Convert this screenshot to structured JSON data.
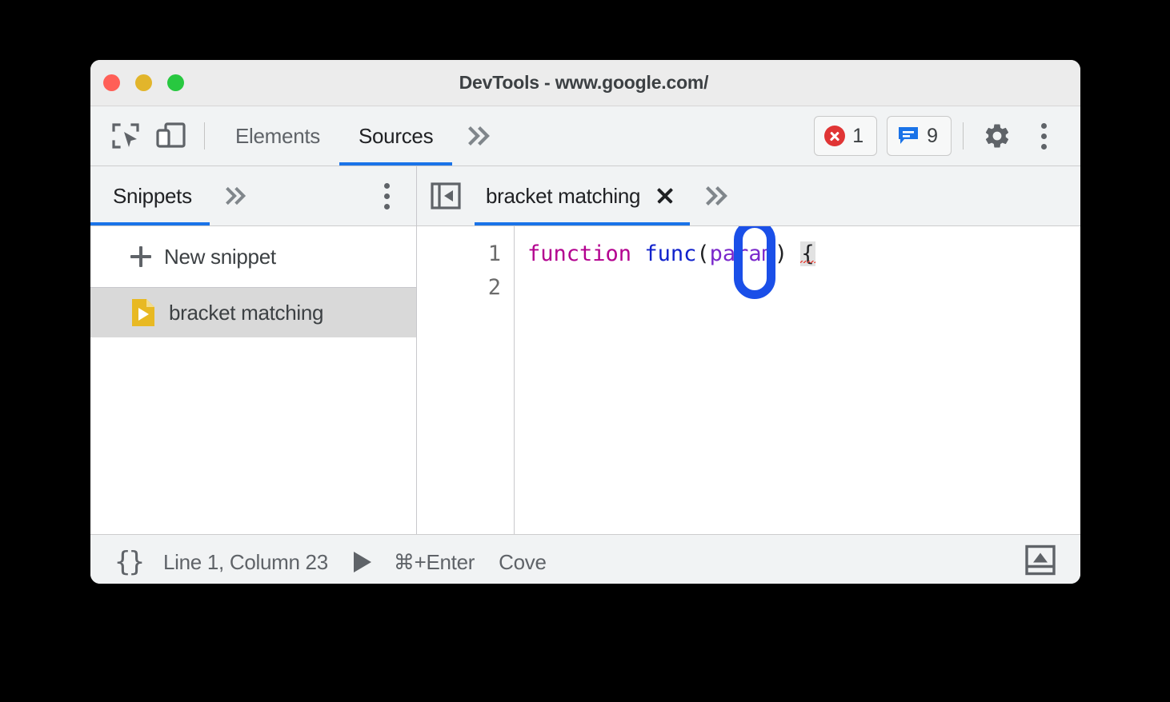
{
  "window": {
    "title": "DevTools - www.google.com/",
    "traffic_lights": [
      {
        "name": "close",
        "color": "#ff5f57"
      },
      {
        "name": "minimize",
        "color": "#e2b52b"
      },
      {
        "name": "maximize",
        "color": "#28c840"
      }
    ]
  },
  "toolbar": {
    "inspect_icon": "inspect-element-icon",
    "device_icon": "device-toolbar-icon",
    "tabs": [
      {
        "label": "Elements",
        "active": false
      },
      {
        "label": "Sources",
        "active": true
      }
    ],
    "more_tabs_label": "»",
    "errors": {
      "count": "1",
      "icon": "error-icon"
    },
    "messages": {
      "count": "9",
      "icon": "message-icon"
    },
    "settings_icon": "gear-icon",
    "menu_icon": "kebab-menu-icon"
  },
  "sidebar": {
    "tab_label": "Snippets",
    "more_label": "»",
    "menu_icon": "kebab-menu-icon",
    "new_snippet_label": "New snippet",
    "items": [
      {
        "label": "bracket matching",
        "icon": "snippet-file-icon",
        "selected": true
      }
    ]
  },
  "editor": {
    "nav_toggle_icon": "show-navigator-icon",
    "tab_label": "bracket matching",
    "close_icon": "close-icon",
    "more_label": "»",
    "line_numbers": [
      "1",
      "2"
    ],
    "code": {
      "keyword": "function",
      "space1": " ",
      "function_name": "func",
      "paren_open": "(",
      "param": "param",
      "paren_close": ")",
      "space2": " ",
      "brace": "{"
    },
    "annotation": {
      "shape": "rounded-rect-highlight",
      "color": "#1a4fe8",
      "target": "{"
    }
  },
  "statusbar": {
    "pretty_print_label": "{}",
    "cursor_position": "Line 1, Column 23",
    "run_icon": "run-triangle-icon",
    "shortcut": "⌘+Enter",
    "coverage_label": "Cove",
    "drawer_icon": "drawer-toggle-icon"
  },
  "colors": {
    "accent": "#1a73e8",
    "annotation": "#1a4fe8",
    "error": "#e03535",
    "message": "#1a73e8",
    "snippet_icon": "#e8b923",
    "keyword": "#b3008f",
    "function": "#1122cc",
    "param": "#7a28cb",
    "squiggle": "#e8453c"
  }
}
